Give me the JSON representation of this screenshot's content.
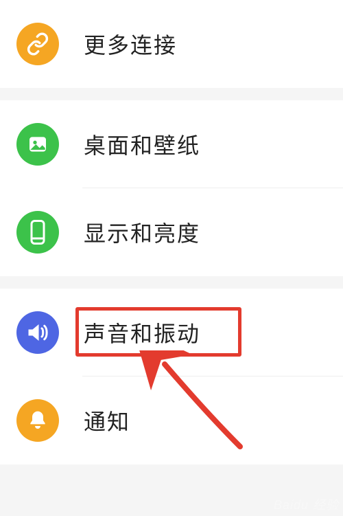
{
  "groups": [
    {
      "items": [
        {
          "id": "more-connections",
          "label": "更多连接",
          "icon": "link-icon",
          "color": "orange"
        }
      ]
    },
    {
      "items": [
        {
          "id": "home-wallpaper",
          "label": "桌面和壁纸",
          "icon": "image-icon",
          "color": "green"
        },
        {
          "id": "display-brightness",
          "label": "显示和亮度",
          "icon": "phone-icon",
          "color": "green"
        }
      ]
    },
    {
      "items": [
        {
          "id": "sound-vibration",
          "label": "声音和振动",
          "icon": "speaker-icon",
          "color": "blue",
          "highlighted": true
        },
        {
          "id": "notifications",
          "label": "通知",
          "icon": "bell-icon",
          "color": "orange"
        }
      ]
    }
  ],
  "watermark": "Baidu 经验"
}
